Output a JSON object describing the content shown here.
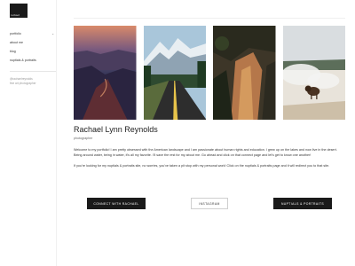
{
  "logo": {
    "text": "rachael"
  },
  "nav": {
    "items": [
      {
        "label": "portfolio",
        "chevron": "⌄"
      },
      {
        "label": "about me"
      },
      {
        "label": "blog"
      },
      {
        "label": "nuptials & portraits"
      }
    ],
    "handle": "@rachaelreynolds",
    "tagline": "fine art photographer"
  },
  "photos": [
    {
      "icon": "canyon-landscape-photo"
    },
    {
      "icon": "mountain-road-photo"
    },
    {
      "icon": "forest-cliff-photo"
    },
    {
      "icon": "bison-geyser-photo"
    }
  ],
  "profile": {
    "name": "Rachael Lynn Reynolds",
    "subtitle": "photographer",
    "bio1": "Welcome to my portfolio! I am pretty obsessed with the American landscape and I am passionate about human rights and education. I grew up on the lakes and now live in the desert. Being around water, being in water, it's all my favorite. I'll save the rest for my about me. Go ahead and click on that connect page and let's get to know one another!",
    "bio2": "If you're looking for my nuptials & portraits site, no worries, you've taken a pit stop with my personal work! Click on the nuptials & portraits page and it will redirect you to that site."
  },
  "buttons": {
    "connect": "connect with rachael",
    "instagram": "instagram",
    "nuptials": "nuptials & portraits"
  },
  "colors": {
    "dark": "#1a1a1a",
    "accent_text": "#333333"
  }
}
